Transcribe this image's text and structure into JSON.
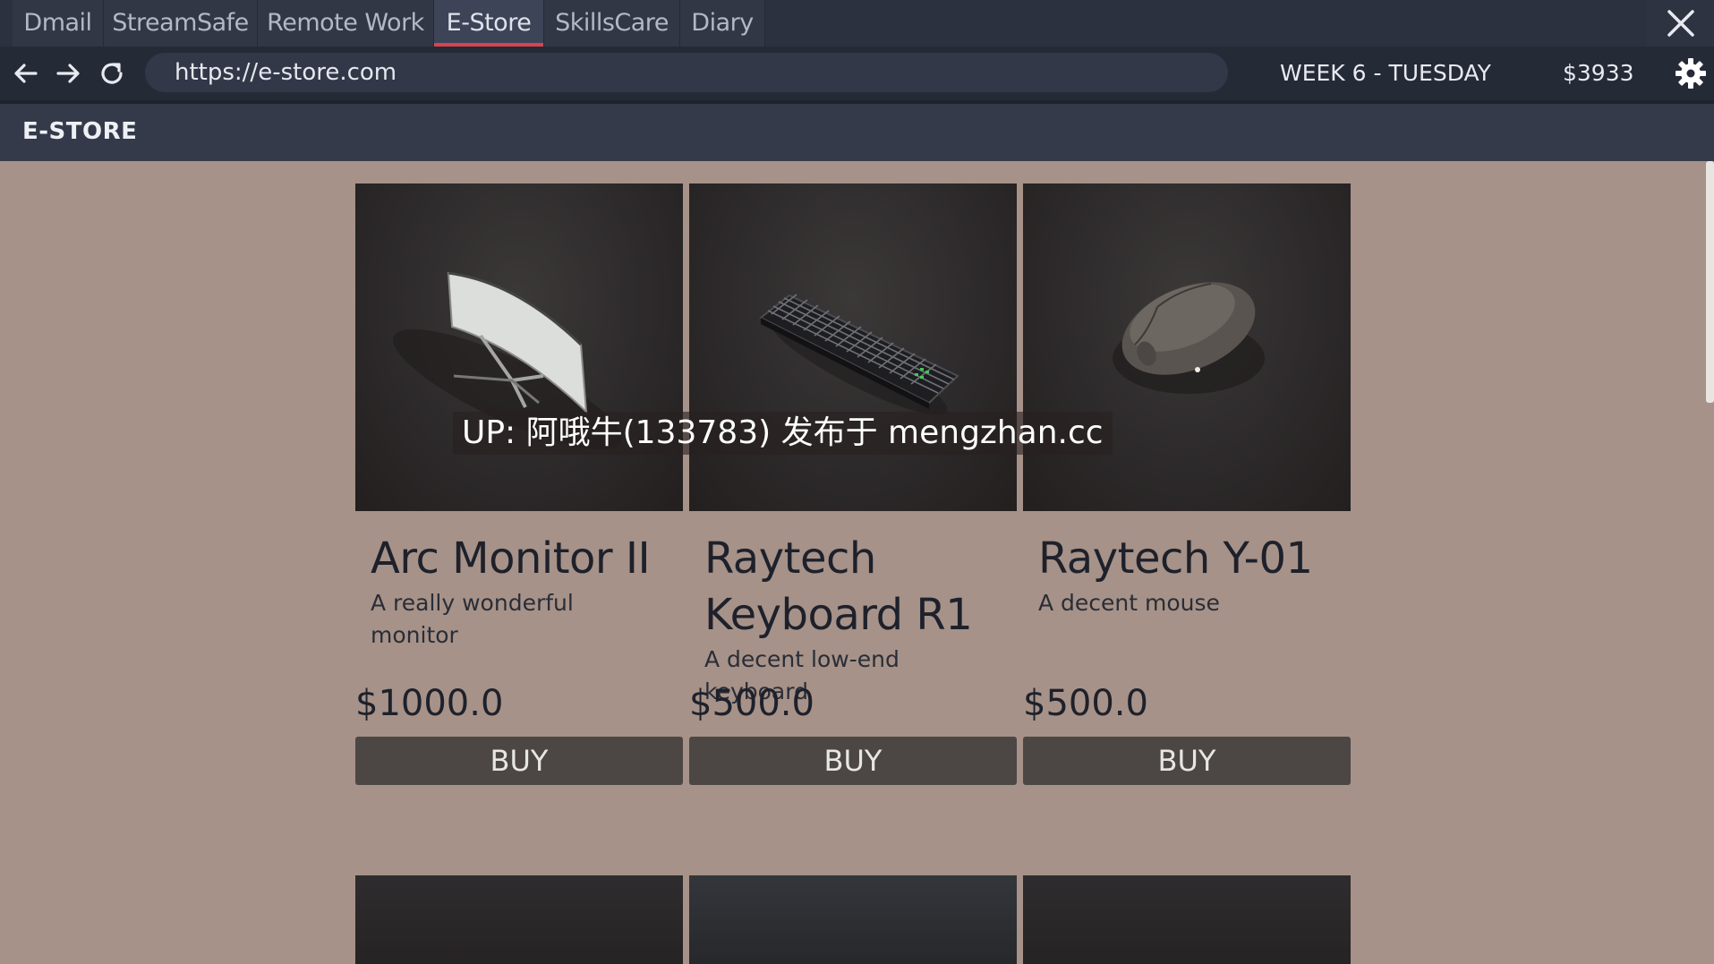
{
  "tabs": [
    {
      "label": "Dmail",
      "active": false
    },
    {
      "label": "StreamSafe",
      "active": false
    },
    {
      "label": "Remote Work",
      "active": false
    },
    {
      "label": "E-Store",
      "active": true
    },
    {
      "label": "SkillsCare",
      "active": false
    },
    {
      "label": "Diary",
      "active": false
    }
  ],
  "window": {
    "close_icon": "close-icon"
  },
  "navbar": {
    "back_icon": "arrow-left-icon",
    "forward_icon": "arrow-right-icon",
    "reload_icon": "reload-icon",
    "url": "https://e-store.com",
    "week_label": "WEEK 6 - TUESDAY",
    "balance": "$3933",
    "settings_icon": "gear-icon"
  },
  "store": {
    "title": "E-STORE",
    "products": [
      {
        "name": "Arc Monitor II",
        "description": "A really wonderful monitor",
        "price": "$1000.0",
        "buy_label": "BUY",
        "image": "monitor-image"
      },
      {
        "name": "Raytech Keyboard R1",
        "description": "A decent low-end keyboard",
        "price": "$500.0",
        "buy_label": "BUY",
        "image": "keyboard-image"
      },
      {
        "name": "Raytech Y-01",
        "description": "A decent mouse",
        "price": "$500.0",
        "buy_label": "BUY",
        "image": "mouse-image"
      }
    ]
  },
  "watermark": "UP: 阿哦牛(133783) 发布于 mengzhan.cc",
  "colors": {
    "page_bg": "#a69288",
    "tab_bar": "#2c3140",
    "active_tab_accent": "#d9434e",
    "buy_button": "#4c4744"
  }
}
